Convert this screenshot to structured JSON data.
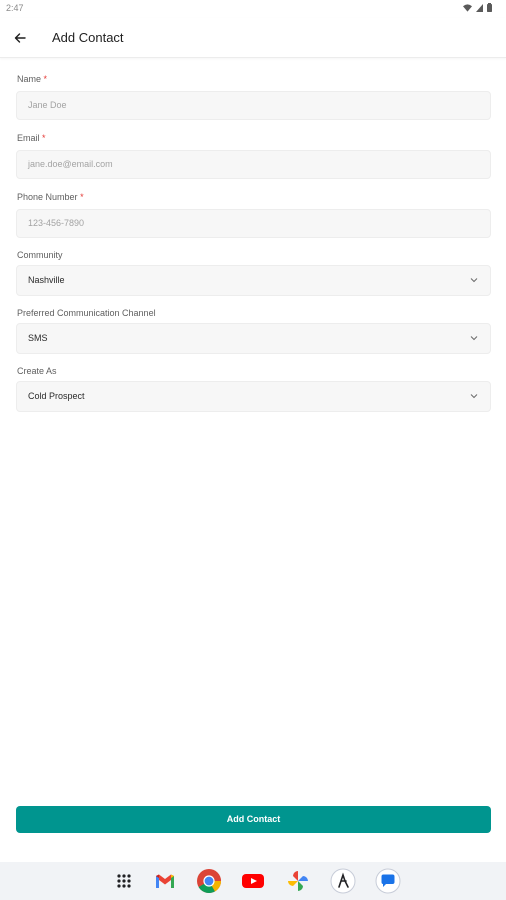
{
  "status_bar": {
    "time": "2:47"
  },
  "app_bar": {
    "title": "Add Contact"
  },
  "form": {
    "name": {
      "label": "Name",
      "required_mark": "*",
      "placeholder": "Jane Doe"
    },
    "email": {
      "label": "Email",
      "required_mark": "*",
      "placeholder": "jane.doe@email.com"
    },
    "phone": {
      "label": "Phone Number",
      "required_mark": "*",
      "placeholder": "123-456-7890"
    },
    "community": {
      "label": "Community",
      "value": "Nashville"
    },
    "channel": {
      "label": "Preferred Communication Channel",
      "value": "SMS"
    },
    "create_as": {
      "label": "Create As",
      "value": "Cold Prospect"
    }
  },
  "submit": {
    "label": "Add Contact"
  },
  "colors": {
    "accent": "#00958f",
    "required": "#e53935"
  },
  "dock": {
    "apps": [
      "app-drawer-icon",
      "gmail-icon",
      "chrome-icon",
      "youtube-icon",
      "photos-icon",
      "app-icon",
      "messages-icon"
    ]
  }
}
